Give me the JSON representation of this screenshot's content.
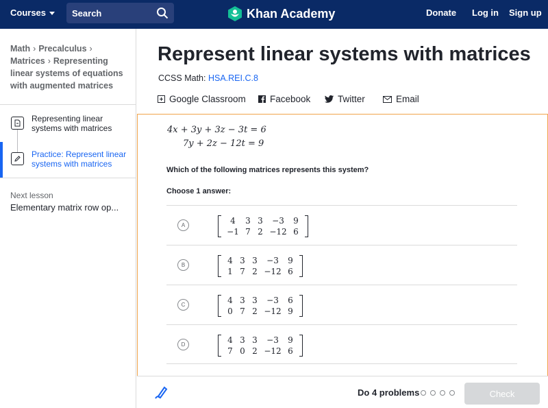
{
  "nav": {
    "courses_label": "Courses",
    "search_placeholder": "Search",
    "logo_text": "Khan Academy",
    "donate": "Donate",
    "login": "Log in",
    "signup": "Sign up"
  },
  "sidebar": {
    "breadcrumb": [
      "Math",
      "Precalculus",
      "Matrices",
      "Representing linear systems of equations with augmented matrices"
    ],
    "items": [
      {
        "label": "Representing linear systems with matrices",
        "icon": "article-icon"
      },
      {
        "label": "Practice: Represent linear systems with matrices",
        "icon": "pencil-icon",
        "active": true
      }
    ],
    "next_label": "Next lesson",
    "next_title": "Elementary matrix row op..."
  },
  "main": {
    "title": "Represent linear systems with matrices",
    "ccss_prefix": "CCSS Math:",
    "ccss_code": "HSA.REI.C.8",
    "share": [
      "Google Classroom",
      "Facebook",
      "Twitter",
      "Email"
    ]
  },
  "exercise": {
    "equations": [
      "4x + 3y + 3z − 3t = 6",
      "7y + 2z − 12t = 9"
    ],
    "question": "Which of the following matrices represents this system?",
    "choose": "Choose 1 answer:",
    "choices": [
      {
        "letter": "A",
        "rows": [
          [
            "4",
            "3",
            "3",
            "−3",
            "9"
          ],
          [
            "−1",
            "7",
            "2",
            "−12",
            "6"
          ]
        ]
      },
      {
        "letter": "B",
        "rows": [
          [
            "4",
            "3",
            "3",
            "−3",
            "9"
          ],
          [
            "1",
            "7",
            "2",
            "−12",
            "6"
          ]
        ]
      },
      {
        "letter": "C",
        "rows": [
          [
            "4",
            "3",
            "3",
            "−3",
            "6"
          ],
          [
            "0",
            "7",
            "2",
            "−12",
            "9"
          ]
        ]
      },
      {
        "letter": "D",
        "rows": [
          [
            "4",
            "3",
            "3",
            "−3",
            "9"
          ],
          [
            "7",
            "0",
            "2",
            "−12",
            "6"
          ]
        ]
      }
    ]
  },
  "footer": {
    "progress_label": "Do 4 problems",
    "check_label": "Check"
  },
  "colors": {
    "nav_bg": "#0a2a66",
    "link": "#1865f2",
    "panel_border": "#f0a349",
    "logo_green": "#14bf96"
  }
}
